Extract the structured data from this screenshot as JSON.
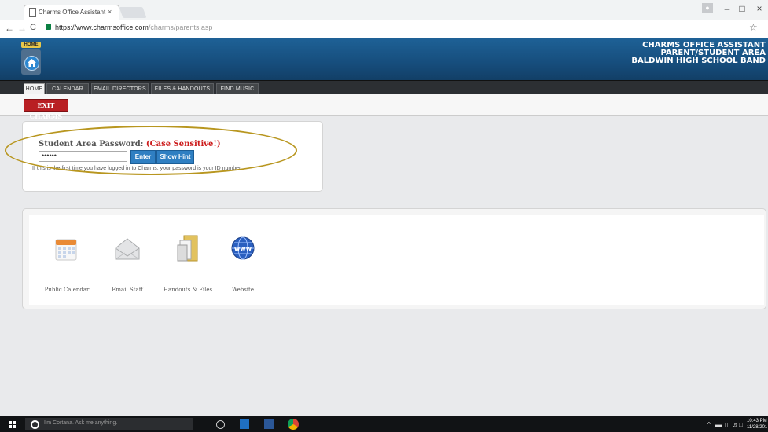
{
  "browser": {
    "tab_title": "Charms Office Assistant",
    "tab_close": "×",
    "url_host": "https://www.charmsoffice.com",
    "url_path": "/charms/parents.asp",
    "nav_back": "←",
    "nav_forward": "→",
    "nav_reload": "C",
    "star": "☆",
    "win_minimize": "–",
    "win_maximize": "□",
    "win_close": "×"
  },
  "header": {
    "home_badge": "HOME",
    "line1": "CHARMS OFFICE ASSISTANT",
    "line2": "PARENT/STUDENT AREA",
    "line3": "BALDWIN HIGH SCHOOL BAND",
    "colors": {
      "header_blue": "#1e6196",
      "exit_red": "#b91f23",
      "button_blue": "#2f7fc2"
    }
  },
  "tabs": [
    {
      "label": "HOME"
    },
    {
      "label": "CALENDAR"
    },
    {
      "label": "EMAIL DIRECTORS"
    },
    {
      "label": "FILES & HANDOUTS"
    },
    {
      "label": "FIND MUSIC"
    }
  ],
  "exit_label": "EXIT CHARMS",
  "login": {
    "label": "Student Area Password:",
    "case_note": "(Case Sensitive!)",
    "password_value": "••••••",
    "enter_label": "Enter",
    "hint_label": "Show Hint",
    "help_text": "If this is the first time you have logged in to Charms, your password is your ID number."
  },
  "quick_links": [
    {
      "label": "Public Calendar",
      "icon": "calendar-icon"
    },
    {
      "label": "Email Staff",
      "icon": "envelope-icon"
    },
    {
      "label": "Handouts & Files",
      "icon": "folder-icon"
    },
    {
      "label": "Website",
      "icon": "globe-icon"
    }
  ],
  "taskbar": {
    "cortana_placeholder": "I'm Cortana. Ask me anything.",
    "time": "10:43 PM",
    "date": "11/28/201"
  }
}
